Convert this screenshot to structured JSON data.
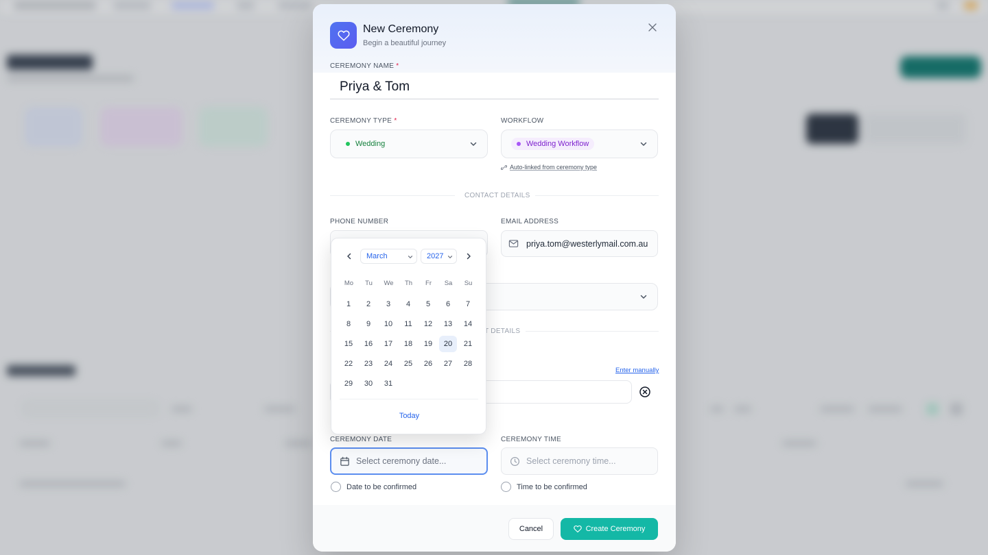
{
  "modal": {
    "title": "New Ceremony",
    "subtitle": "Begin a beautiful journey",
    "header_icon": "heart-icon",
    "close_icon": "close-icon"
  },
  "ceremony_name": {
    "label": "CEREMONY NAME",
    "required_mark": "*",
    "value": "Priya & Tom"
  },
  "ceremony_type": {
    "label": "CEREMONY TYPE",
    "required_mark": "*",
    "value": "Wedding",
    "dot_color": "#22c55e",
    "text_color": "#15803d"
  },
  "workflow": {
    "label": "WORKFLOW",
    "value": "Wedding Workflow",
    "dot_color": "#a855f7",
    "text_color": "#7e22ce",
    "hint": "Auto-linked from ceremony type"
  },
  "contact_details": {
    "divider": "CONTACT DETAILS",
    "phone_label": "PHONE NUMBER",
    "email_label": "EMAIL ADDRESS",
    "email_value": "priya.tom@westerlymail.com.au"
  },
  "event_details": {
    "divider_partial": "T DETAILS",
    "enter_manually": "Enter manually"
  },
  "date_time": {
    "date_label": "CEREMONY DATE",
    "date_placeholder": "Select ceremony date...",
    "time_label": "CEREMONY TIME",
    "time_placeholder": "Select ceremony time...",
    "date_tbc": "Date to be confirmed",
    "time_tbc": "Time to be confirmed"
  },
  "footer": {
    "cancel": "Cancel",
    "create": "Create Ceremony"
  },
  "calendar": {
    "month": "March",
    "year": "2027",
    "weekdays": [
      "Mo",
      "Tu",
      "We",
      "Th",
      "Fr",
      "Sa",
      "Su"
    ],
    "days": [
      "1",
      "2",
      "3",
      "4",
      "5",
      "6",
      "7",
      "8",
      "9",
      "10",
      "11",
      "12",
      "13",
      "14",
      "15",
      "16",
      "17",
      "18",
      "19",
      "20",
      "21",
      "22",
      "23",
      "24",
      "25",
      "26",
      "27",
      "28",
      "29",
      "30",
      "31"
    ],
    "selected_day": "20",
    "today_label": "Today",
    "accent": "#2563eb"
  },
  "colors": {
    "primary": "#14b8a6",
    "focus_border": "#5b8def",
    "icon_gradient_start": "#4f73f0"
  }
}
